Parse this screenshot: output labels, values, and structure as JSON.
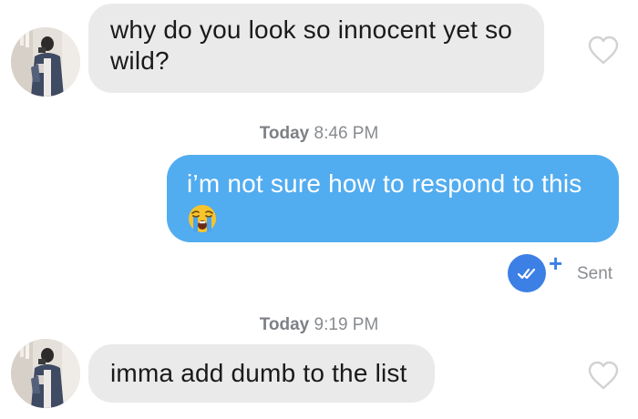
{
  "conversation": {
    "messages": [
      {
        "direction": "incoming",
        "text": "why do you look so innocent yet so wild?"
      },
      {
        "direction": "outgoing",
        "text": "i’m not sure how to respond to this",
        "emoji": "loudly-crying-face"
      },
      {
        "direction": "incoming",
        "text": "imma add dumb to the list"
      }
    ],
    "timestamps": [
      {
        "day": "Today",
        "time": "8:46 PM"
      },
      {
        "day": "Today",
        "time": "9:19 PM"
      }
    ],
    "status": {
      "sent_label": "Sent",
      "plus_label": "+"
    }
  },
  "icons": {
    "like": "heart-outline-icon",
    "read_receipt": "double-check-icon"
  },
  "colors": {
    "outgoing_bubble": "#52acf0",
    "incoming_bubble": "#eaeaea",
    "read_badge": "#3c7fe5",
    "heart_outline": "#d2d2d2",
    "timestamp_text": "#888b8f"
  }
}
